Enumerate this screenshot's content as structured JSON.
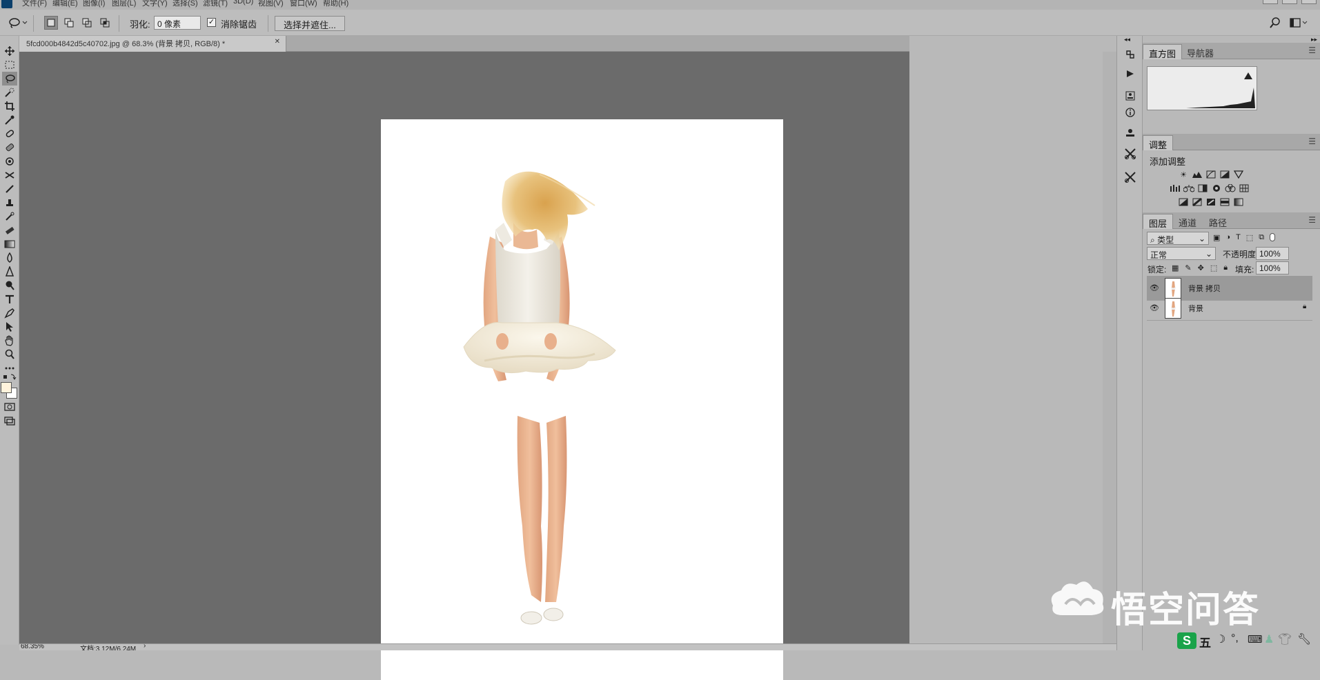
{
  "menubar": {
    "items": [
      "文件(F)",
      "编辑(E)",
      "图像(I)",
      "图层(L)",
      "文字(Y)",
      "选择(S)",
      "滤镜(T)",
      "3D(D)",
      "视图(V)",
      "窗口(W)",
      "帮助(H)"
    ]
  },
  "options": {
    "feather_label": "羽化:",
    "feather_value": "0 像素",
    "antialias_label": "消除锯齿",
    "antialias_checked": true,
    "select_mask_button": "选择并遮住..."
  },
  "document": {
    "tab_title": "5fcd000b4842d5c40702.jpg @ 68.3% (背景 拷贝, RGB/8) *"
  },
  "status": {
    "zoom": "68.35%",
    "doc_size": "文档:3.12M/6.24M"
  },
  "panels": {
    "histogram_tabs": [
      "直方图",
      "导航器"
    ],
    "adjustments_tab": "调整",
    "add_adjustment": "添加调整",
    "layers_tabs": [
      "图层",
      "通道",
      "路径"
    ],
    "filter_kind": "类型",
    "blend_mode": "正常",
    "opacity_label": "不透明度:",
    "opacity_value": "100%",
    "lock_label": "锁定:",
    "fill_label": "填充:",
    "fill_value": "100%",
    "layers": [
      {
        "name": "背景 拷贝",
        "selected": true,
        "locked": false
      },
      {
        "name": "背景",
        "selected": false,
        "locked": true
      }
    ]
  },
  "watermark": {
    "text": "悟空问答"
  },
  "ime": {
    "label": "五"
  },
  "colors": {
    "canvas_bg": "#6b6b6b",
    "foreground_swatch": "#fff3dc",
    "background_swatch": "#ffffff"
  }
}
